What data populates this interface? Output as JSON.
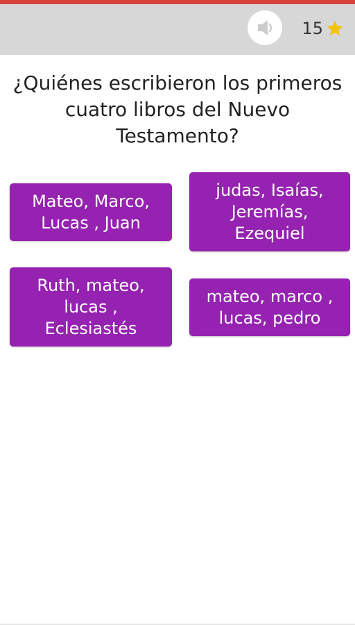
{
  "colors": {
    "top_accent": "#d9413f",
    "header_bg": "#d7d7d7",
    "answer_bg": "#9522b0",
    "star": "#f4c20d"
  },
  "header": {
    "sound_icon": "speaker-icon",
    "score": "15",
    "score_icon": "star-icon"
  },
  "question": {
    "text": "¿Quiénes escribieron los primeros cuatro libros del Nuevo Testamento?"
  },
  "answers": [
    {
      "label": "Mateo, Marco,\nLucas , Juan"
    },
    {
      "label": "judas, Isaías,\nJeremías,\nEzequiel"
    },
    {
      "label": "Ruth, mateo,\nlucas ,\nEclesiastés"
    },
    {
      "label": "mateo, marco ,\nlucas, pedro"
    }
  ]
}
